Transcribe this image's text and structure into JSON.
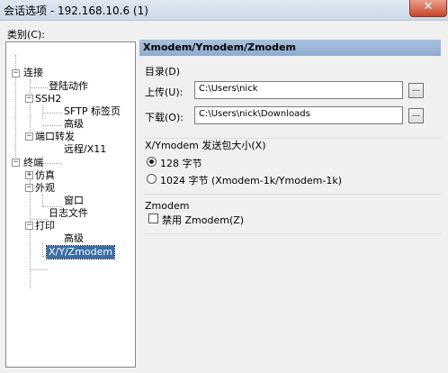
{
  "window": {
    "title": "会话选项 - 192.168.10.6 (1)",
    "close_glyph": "✕"
  },
  "category_label": "类别(C):",
  "tree": {
    "items": [
      {
        "label": "连接",
        "toggle": "−"
      },
      {
        "label": "登陆动作"
      },
      {
        "label": "SSH2",
        "toggle": "−"
      },
      {
        "label": "SFTP 标签页"
      },
      {
        "label": "高级"
      },
      {
        "label": "端口转发",
        "toggle": "−"
      },
      {
        "label": "远程/X11"
      },
      {
        "label": "终端",
        "toggle": "−"
      },
      {
        "label": "仿真",
        "toggle": "+"
      },
      {
        "label": "外观",
        "toggle": "−"
      },
      {
        "label": "窗口"
      },
      {
        "label": "日志文件"
      },
      {
        "label": "打印",
        "toggle": "−"
      },
      {
        "label": "高级"
      },
      {
        "label": "X/Y/Zmodem",
        "selected": true
      }
    ]
  },
  "panel": {
    "header": "Xmodem/Ymodem/Zmodem",
    "dirs": {
      "title": "目录(D)",
      "upload_label": "上传(U):",
      "upload_value": "C:\\Users\\nick",
      "download_label": "下载(O):",
      "download_value": "C:\\Users\\nick\\Downloads",
      "browse_glyph": "..."
    },
    "packet": {
      "title": "X/Ymodem 发送包大小(X)",
      "opt128": "128 字节",
      "opt1024": "1024 字节  (Xmodem-1k/Ymodem-1k)",
      "selected": "128"
    },
    "zmodem": {
      "title": "Zmodem",
      "disable_label": "禁用 Zmodem(Z)",
      "disable_checked": false
    }
  }
}
